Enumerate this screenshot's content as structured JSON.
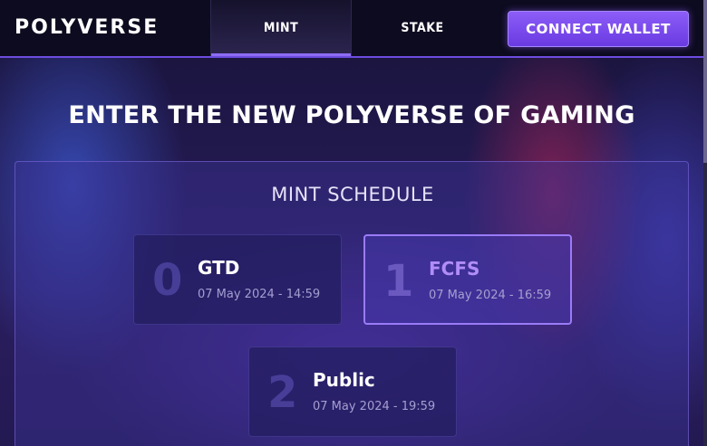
{
  "header": {
    "logo": "POLYVERSE",
    "nav": {
      "mint": "MINT",
      "stake": "STAKE"
    },
    "connect_wallet": "CONNECT WALLET"
  },
  "hero": {
    "title": "ENTER THE NEW POLYVERSE OF GAMING"
  },
  "schedule": {
    "title": "MINT SCHEDULE",
    "phases": [
      {
        "number": "0",
        "name": "GTD",
        "date": "07 May 2024 - 14:59",
        "active": false
      },
      {
        "number": "1",
        "name": "FCFS",
        "date": "07 May 2024 - 16:59",
        "active": true
      },
      {
        "number": "2",
        "name": "Public",
        "date": "07 May 2024 - 19:59",
        "active": false
      }
    ]
  },
  "colors": {
    "accent": "#8c5df7",
    "active_phase_text": "#b18df8",
    "header_bg": "#0d0b1f"
  }
}
